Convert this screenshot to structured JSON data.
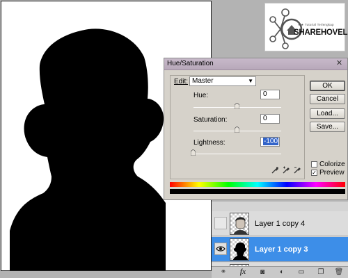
{
  "dialog": {
    "title": "Hue/Saturation",
    "edit_label": "Edit:",
    "edit_value": "Master",
    "hue": {
      "label": "Hue:",
      "value": "0",
      "slider_fraction": 0.5
    },
    "saturation": {
      "label": "Saturation:",
      "value": "0",
      "slider_fraction": 0.5
    },
    "lightness": {
      "label": "Lightness:",
      "value": "-100",
      "slider_fraction": 0.0
    },
    "buttons": {
      "ok": "OK",
      "cancel": "Cancel",
      "load": "Load...",
      "save": "Save..."
    },
    "colorize": {
      "label": "Colorize",
      "checked": false
    },
    "preview": {
      "label": "Preview",
      "checked": true
    }
  },
  "layers": [
    {
      "name": "Layer 1 copy 4",
      "visible": false,
      "selected": false
    },
    {
      "name": "Layer 1 copy 3",
      "visible": true,
      "selected": true
    }
  ],
  "watermark": {
    "small": "★★ Tutorial Terlengkap",
    "big": "SHAREHOVEL"
  },
  "toolbar_icons": [
    "link-icon",
    "fx-icon",
    "mask-icon",
    "adjustment-icon",
    "group-icon",
    "new-layer-icon",
    "trash-icon"
  ],
  "colors": {
    "selected_layer": "#3d8ee8",
    "canvas_bg": "#ffffff",
    "silhouette": "#000000"
  }
}
